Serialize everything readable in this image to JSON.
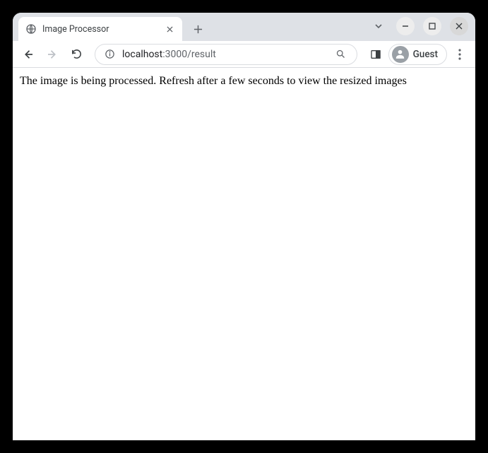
{
  "tab": {
    "title": "Image Processor"
  },
  "address": {
    "prefix": "localhost",
    "port_path": ":3000/result"
  },
  "profile": {
    "label": "Guest"
  },
  "page": {
    "message": "The image is being processed. Refresh after a few seconds to view the resized images"
  }
}
